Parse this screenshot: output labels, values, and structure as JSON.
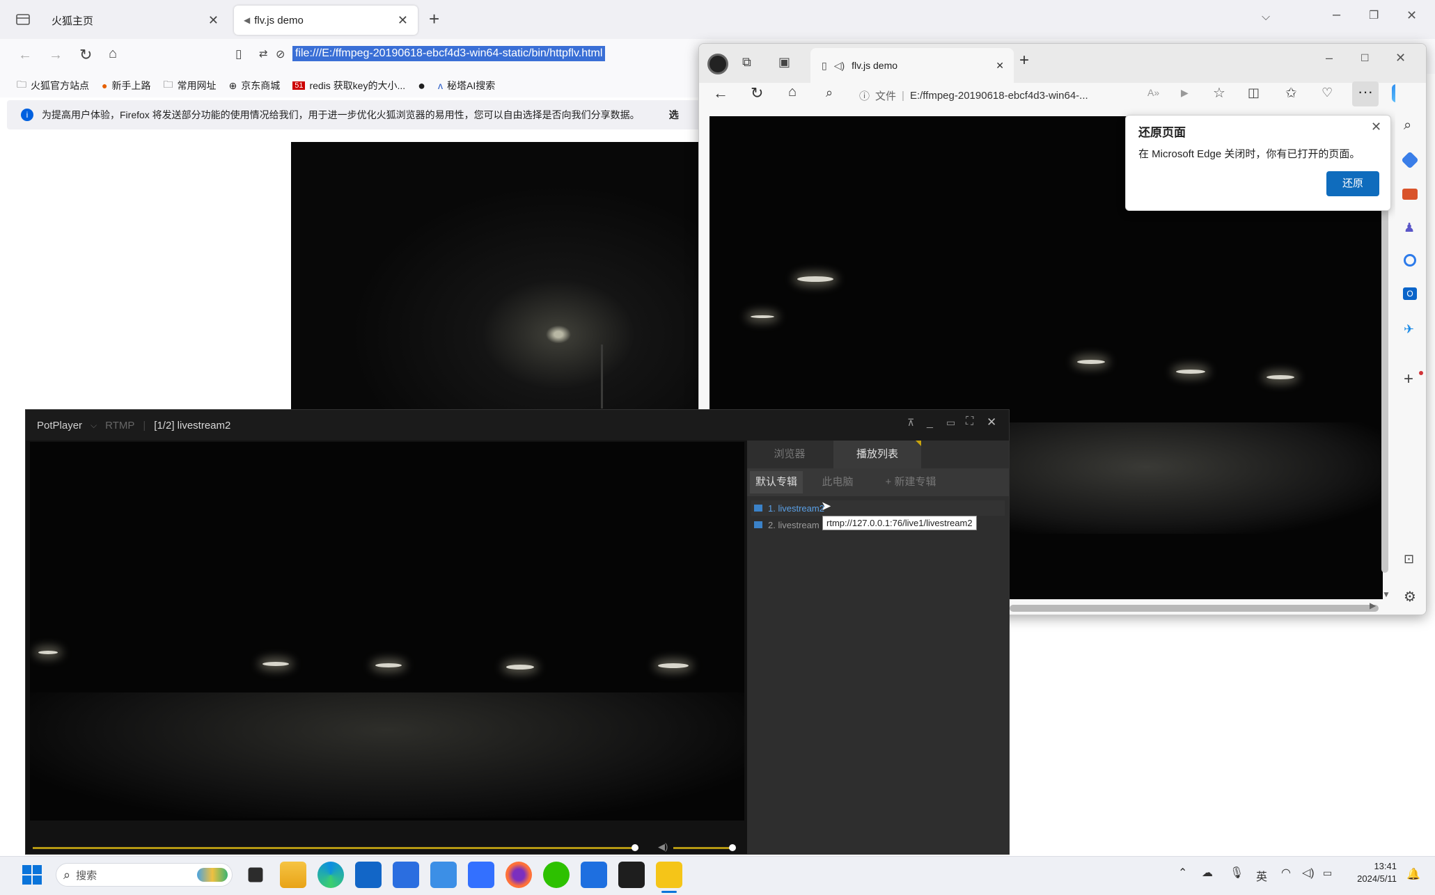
{
  "firefox": {
    "tabs": [
      {
        "title": "火狐主页"
      },
      {
        "title": "flv.js demo"
      }
    ],
    "url": "file:///E:/ffmpeg-20190618-ebcf4d3-win64-static/bin/httpflv.html",
    "bookmarks": [
      "火狐官方站点",
      "新手上路",
      "常用网址",
      "京东商城",
      "redis 获取key的大小...",
      "秘塔AI搜索"
    ],
    "notice": "为提高用户体验，Firefox 将发送部分功能的使用情况给我们，用于进一步优化火狐浏览器的易用性，您可以自由选择是否向我们分享数据。",
    "notice_more": "选"
  },
  "edge": {
    "tab_title": "flv.js demo",
    "address_label": "文件",
    "address": "E:/ffmpeg-20190618-ebcf4d3-win64-...",
    "popup": {
      "title": "还原页面",
      "message": "在 Microsoft Edge 关闭时，你有已打开的页面。",
      "button": "还原"
    }
  },
  "potplayer": {
    "app_name": "PotPlayer",
    "protocol": "RTMP",
    "title": "[1/2] livestream2",
    "tabs": [
      "浏览器",
      "播放列表"
    ],
    "subtabs": [
      "默认专辑",
      "此电脑",
      "+ 新建专辑"
    ],
    "playlist": [
      "1. livestream2",
      "2. livestream"
    ],
    "tooltip": "rtmp://127.0.0.1:76/live1/livestream2",
    "progress": 0.9,
    "volume": 1.0
  },
  "taskbar": {
    "search_placeholder": "搜索",
    "ime": "英",
    "time": "13:41",
    "date": "2024/5/11"
  },
  "colors": {
    "edge_accent": "#0f6cbd",
    "potplayer_accent": "#b59812"
  }
}
